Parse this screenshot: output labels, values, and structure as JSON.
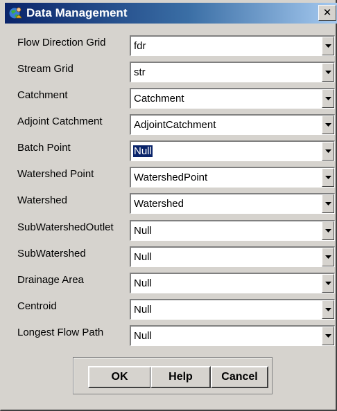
{
  "window": {
    "title": "Data Management",
    "close_glyph": "✕"
  },
  "rows": [
    {
      "label": "Flow Direction Grid",
      "value": "fdr"
    },
    {
      "label": "Stream Grid",
      "value": "str"
    },
    {
      "label": "Catchment",
      "value": "Catchment"
    },
    {
      "label": "Adjoint Catchment",
      "value": "AdjointCatchment"
    },
    {
      "label": "Batch Point",
      "value": "Null",
      "selected": true
    },
    {
      "label": "Watershed Point",
      "value": "WatershedPoint"
    },
    {
      "label": "Watershed",
      "value": "Watershed"
    },
    {
      "label": "SubWatershedOutlet",
      "value": "Null"
    },
    {
      "label": "SubWatershed",
      "value": "Null"
    },
    {
      "label": "Drainage Area",
      "value": "Null"
    },
    {
      "label": "Centroid",
      "value": "Null"
    },
    {
      "label": "Longest Flow Path",
      "value": "Null"
    }
  ],
  "buttons": {
    "ok": "OK",
    "help": "Help",
    "cancel": "Cancel"
  },
  "colors": {
    "dialog_bg": "#d6d3ce",
    "title_start": "#0a246a",
    "title_end": "#a6caf0",
    "selection": "#0a246a"
  },
  "icons": {
    "title": "globe-person-icon",
    "dropdown": "chevron-down-icon"
  }
}
